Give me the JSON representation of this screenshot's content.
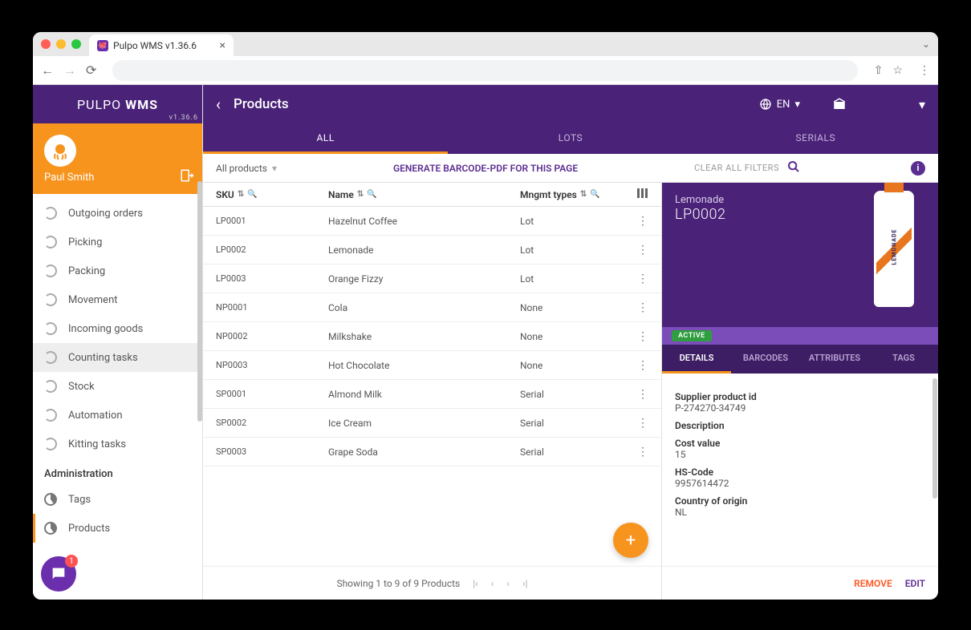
{
  "browser": {
    "tab_title": "Pulpo WMS v1.36.6"
  },
  "logo": {
    "part1": "PULPO ",
    "part2": "WMS"
  },
  "version": "v1.36.6",
  "user": {
    "name": "Paul Smith"
  },
  "chat_badge": "1",
  "sidebar": {
    "items": [
      {
        "label": "Outgoing orders"
      },
      {
        "label": "Picking"
      },
      {
        "label": "Packing"
      },
      {
        "label": "Movement"
      },
      {
        "label": "Incoming goods"
      },
      {
        "label": "Counting tasks"
      },
      {
        "label": "Stock"
      },
      {
        "label": "Automation"
      },
      {
        "label": "Kitting tasks"
      }
    ],
    "admin_title": "Administration",
    "admin_items": [
      {
        "label": "Tags"
      },
      {
        "label": "Products"
      }
    ]
  },
  "header": {
    "title": "Products",
    "language": "EN"
  },
  "subtabs": [
    {
      "label": "ALL",
      "active": true
    },
    {
      "label": "LOTS",
      "active": false
    },
    {
      "label": "SERIALS",
      "active": false
    }
  ],
  "filter_bar": {
    "dropdown": "All products",
    "generate_barcode": "GENERATE BARCODE-PDF FOR THIS PAGE",
    "clear_filters": "CLEAR ALL FILTERS"
  },
  "table": {
    "headers": {
      "sku": "SKU",
      "name": "Name",
      "mgmt": "Mngmt types"
    },
    "rows": [
      {
        "sku": "LP0001",
        "name": "Hazelnut Coffee",
        "mgmt": "Lot"
      },
      {
        "sku": "LP0002",
        "name": "Lemonade",
        "mgmt": "Lot"
      },
      {
        "sku": "LP0003",
        "name": "Orange Fizzy",
        "mgmt": "Lot"
      },
      {
        "sku": "NP0001",
        "name": "Cola",
        "mgmt": "None"
      },
      {
        "sku": "NP0002",
        "name": "Milkshake",
        "mgmt": "None"
      },
      {
        "sku": "NP0003",
        "name": "Hot Chocolate",
        "mgmt": "None"
      },
      {
        "sku": "SP0001",
        "name": "Almond Milk",
        "mgmt": "Serial"
      },
      {
        "sku": "SP0002",
        "name": "Ice Cream",
        "mgmt": "Serial"
      },
      {
        "sku": "SP0003",
        "name": "Grape Soda",
        "mgmt": "Serial"
      }
    ]
  },
  "pagination": "Showing 1 to 9 of 9 Products",
  "details": {
    "name": "Lemonade",
    "sku": "LP0002",
    "status": "ACTIVE",
    "bottle_label": "LEMONADE",
    "tabs": [
      {
        "label": "DETAILS",
        "active": true
      },
      {
        "label": "BARCODES",
        "active": false
      },
      {
        "label": "ATTRIBUTES",
        "active": false
      },
      {
        "label": "TAGS",
        "active": false
      }
    ],
    "fields": [
      {
        "label": "Supplier product id",
        "value": "P-274270-34749"
      },
      {
        "label": "Description",
        "value": ""
      },
      {
        "label": "Cost value",
        "value": "15"
      },
      {
        "label": "HS-Code",
        "value": "9957614472"
      },
      {
        "label": "Country of origin",
        "value": "NL"
      }
    ],
    "remove": "REMOVE",
    "edit": "EDIT"
  }
}
